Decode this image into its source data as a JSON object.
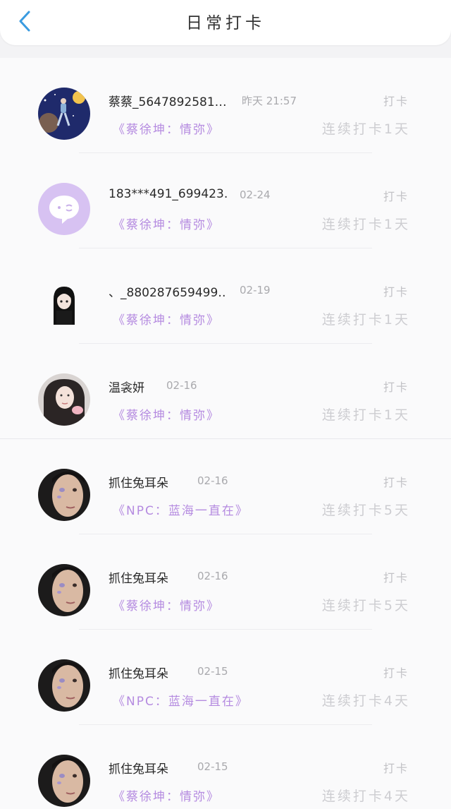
{
  "header": {
    "title": "日常打卡"
  },
  "items": [
    {
      "name": "蔡蔡_5647892581…",
      "time": "昨天 21:57",
      "song": "《蔡徐坤：情弥》",
      "clock_label": "打卡",
      "streak": "连续打卡1天",
      "avatar": "avatar-night-scene"
    },
    {
      "name": "183***491_699423…",
      "time": "02-24",
      "song": "《蔡徐坤：情弥》",
      "clock_label": "打卡",
      "streak": "连续打卡1天",
      "avatar": "avatar-default-chat"
    },
    {
      "name": "、_880287659499…",
      "time": "02-19",
      "song": "《蔡徐坤：情弥》",
      "clock_label": "打卡",
      "streak": "连续打卡1天",
      "avatar": "avatar-anime-girl"
    },
    {
      "name": "温衾妍",
      "time": "02-16",
      "song": "《蔡徐坤：情弥》",
      "clock_label": "打卡",
      "streak": "连续打卡1天",
      "avatar": "avatar-photo-girl"
    },
    {
      "name": "抓住兔耳朵",
      "time": "02-16",
      "song": "《NPC：蓝海一直在》",
      "clock_label": "打卡",
      "streak": "连续打卡5天",
      "avatar": "avatar-photo-face"
    },
    {
      "name": "抓住兔耳朵",
      "time": "02-16",
      "song": "《蔡徐坤：情弥》",
      "clock_label": "打卡",
      "streak": "连续打卡5天",
      "avatar": "avatar-photo-face"
    },
    {
      "name": "抓住兔耳朵",
      "time": "02-15",
      "song": "《NPC：蓝海一直在》",
      "clock_label": "打卡",
      "streak": "连续打卡4天",
      "avatar": "avatar-photo-face"
    },
    {
      "name": "抓住兔耳朵",
      "time": "02-15",
      "song": "《蔡徐坤：情弥》",
      "clock_label": "打卡",
      "streak": "连续打卡4天",
      "avatar": "avatar-photo-face"
    }
  ],
  "colors": {
    "accent_blue": "#3a9be0",
    "song_purple": "#b58be0",
    "default_avatar": "#d7c2f2"
  }
}
